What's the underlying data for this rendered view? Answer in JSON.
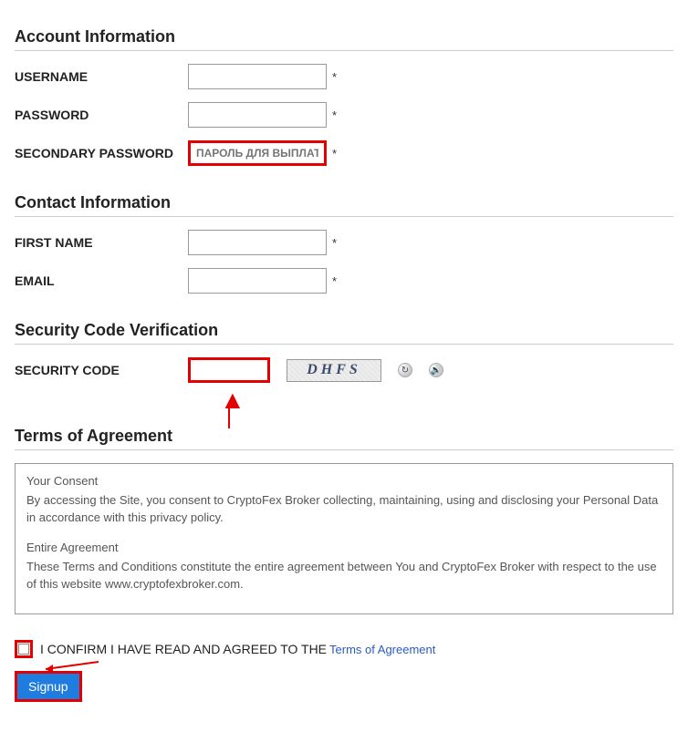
{
  "sections": {
    "account": "Account Information",
    "contact": "Contact Information",
    "security": "Security Code Verification",
    "terms": "Terms of Agreement"
  },
  "labels": {
    "username": "USERNAME",
    "password": "PASSWORD",
    "secondary_password": "SECONDARY PASSWORD",
    "first_name": "FIRST NAME",
    "email": "EMAIL",
    "security_code": "SECURITY CODE"
  },
  "placeholders": {
    "secondary_password": "ПАРОЛЬ ДЛЯ ВЫПЛАТ"
  },
  "asterisk": "*",
  "captcha_text": "DHFS",
  "terms_text": {
    "p1_title": "Your Consent",
    "p1": "By accessing the Site, you consent to CryptoFex Broker collecting, maintaining, using and disclosing your Personal Data in accordance with this privacy policy.",
    "p2_title": " Entire Agreement",
    "p2": "These Terms and Conditions constitute the entire agreement between You and CryptoFex Broker with respect to the use of this website www.cryptofexbroker.com."
  },
  "confirm_text": "I CONFIRM I HAVE READ AND AGREED TO THE",
  "terms_link_text": "Terms of Agreement",
  "signup_label": "Signup"
}
